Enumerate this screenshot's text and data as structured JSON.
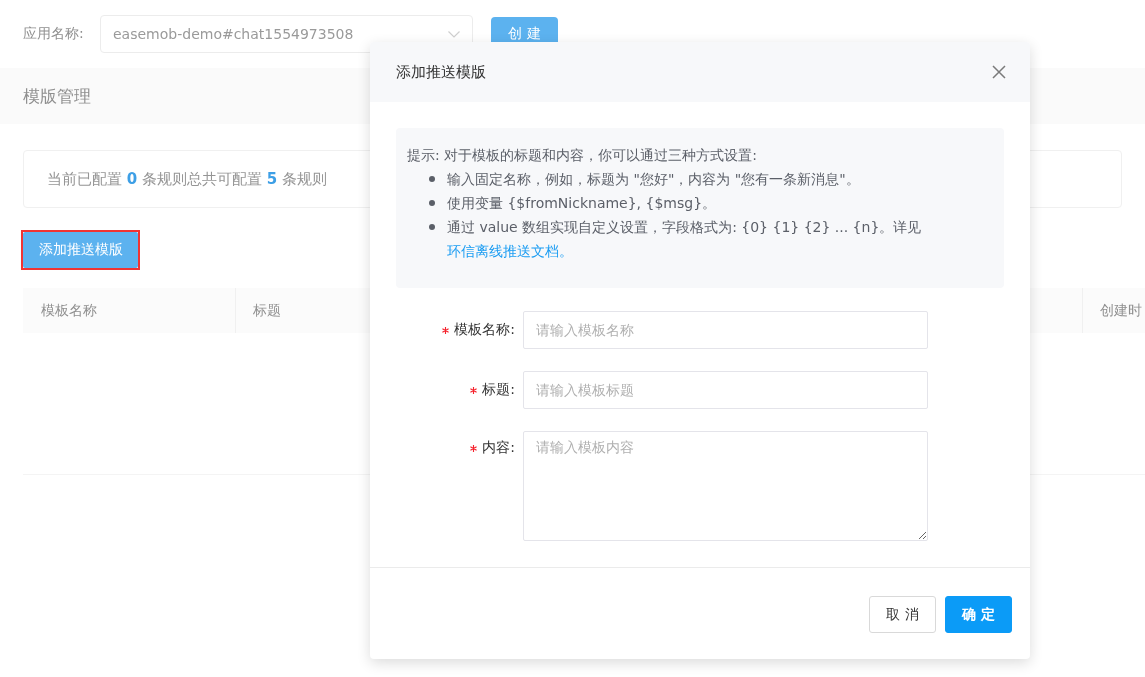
{
  "app_bar": {
    "label": "应用名称:",
    "app_select": {
      "value": "easemob-demo#chat1554973508"
    },
    "create_button": "创 建"
  },
  "section": {
    "title": "模版管理"
  },
  "summary": {
    "text": "当前已配置 **0** 条规则总共可配置 **5** 条规则"
  },
  "add_template_button": {
    "label": "添加推送模版",
    "highlighted": true
  },
  "table": {
    "columns": [
      "模板名称",
      "标题",
      "创建时"
    ]
  },
  "dialog": {
    "title": "添加推送模版",
    "tip": {
      "intro": "提示: 对于模板的标题和内容，你可以通过三种方式设置:",
      "items": [
        {
          "text": "输入固定名称，例如，标题为 \"您好\"，内容为 \"您有一条新消息\"。"
        },
        {
          "text": "使用变量 {$fromNickname}, {$msg}。"
        },
        {
          "text": "通过 value 数组实现自定义设置，字段格式为: {0} {1} {2} ... {n}。详见",
          "link": "环信离线推送文档。"
        }
      ]
    },
    "fields": [
      {
        "kind": "input",
        "label": "模板名称:",
        "required": true,
        "placeholder": "请输入模板名称"
      },
      {
        "kind": "input",
        "label": "标题:",
        "required": true,
        "placeholder": "请输入模板标题"
      },
      {
        "kind": "textarea",
        "label": "内容:",
        "required": true,
        "placeholder": "请输入模板内容"
      }
    ],
    "buttons": [
      {
        "kind": "default",
        "label": "取 消"
      },
      {
        "kind": "primary",
        "label": "确 定"
      }
    ]
  }
}
